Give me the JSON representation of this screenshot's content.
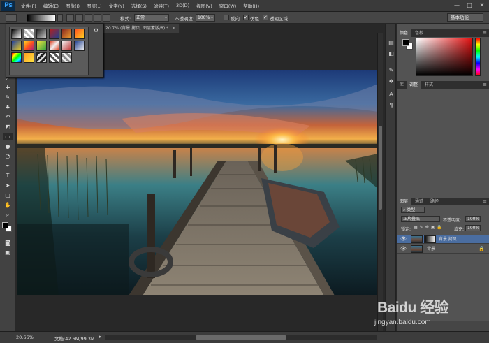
{
  "app": {
    "logo": "Ps"
  },
  "menubar": {
    "items": [
      "文件(F)",
      "编辑(E)",
      "图像(I)",
      "图层(L)",
      "文字(Y)",
      "选择(S)",
      "滤镜(T)",
      "3D(D)",
      "视图(V)",
      "窗口(W)",
      "帮助(H)"
    ]
  },
  "window_controls": {
    "minimize": "—",
    "restore": "□",
    "close": "✕"
  },
  "options": {
    "mode_label": "模式:",
    "mode_value": "正常",
    "opacity_label": "不透明度:",
    "opacity_value": "100%",
    "reverse_label": "反向",
    "dither_label": "仿色",
    "transparency_label": "透明区域",
    "workspace": "基本功能"
  },
  "document": {
    "tab_title": "20.7% (背景 拷贝, 图层蒙版/8) *",
    "tab_close": "×"
  },
  "panels": {
    "color_tabs": [
      "颜色",
      "色板"
    ],
    "adjust_tabs": [
      "库",
      "调整",
      "样式"
    ],
    "layers_tabs": [
      "图层",
      "通道",
      "路径"
    ],
    "filter_kind": "类型",
    "blend_mode": "正片叠底",
    "opacity_label": "不透明度:",
    "opacity_value": "100%",
    "lock_label": "锁定:",
    "fill_label": "填充:",
    "fill_value": "100%",
    "layers": [
      {
        "name": "背景 拷贝",
        "selected": true
      },
      {
        "name": "背景",
        "selected": false
      }
    ]
  },
  "statusbar": {
    "zoom": "20.66%",
    "doc_info": "文档:42.6M/99.3M",
    "arrow": "▸"
  },
  "watermark": {
    "text": "Baidu 经验",
    "url": "jingyan.baidu.com"
  },
  "icons": {
    "toolbar": [
      "move-tool-icon",
      "marquee-tool-icon",
      "lasso-tool-icon",
      "quick-select-tool-icon",
      "crop-tool-icon",
      "eyedropper-tool-icon",
      "healing-brush-icon",
      "brush-tool-icon",
      "clone-stamp-icon",
      "history-brush-icon",
      "eraser-tool-icon",
      "gradient-tool-icon",
      "blur-tool-icon",
      "dodge-tool-icon",
      "pen-tool-icon",
      "type-tool-icon",
      "path-select-icon",
      "shape-tool-icon",
      "hand-tool-icon",
      "zoom-tool-icon"
    ],
    "gradient_gear": "gear-icon"
  },
  "colors": {
    "foreground": "#000000",
    "background": "#ffffff",
    "accent": "#4a6da0"
  }
}
